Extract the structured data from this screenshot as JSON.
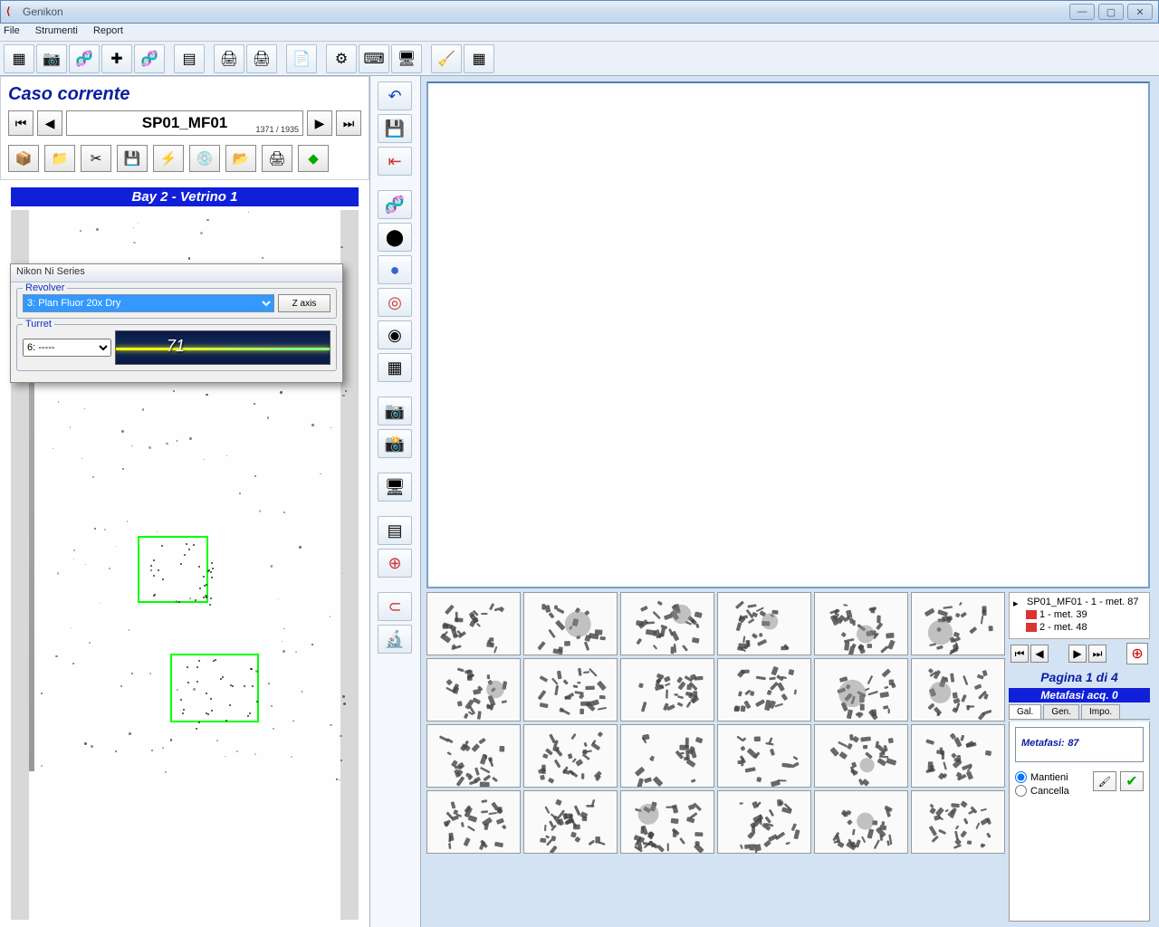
{
  "window": {
    "title": "Genikon"
  },
  "menu": {
    "file": "File",
    "tools": "Strumenti",
    "report": "Report"
  },
  "caso": {
    "title": "Caso corrente",
    "id": "SP01_MF01",
    "counter": "1371 / 1935"
  },
  "bay": {
    "label": "Bay 2 - Vetrino 1"
  },
  "nikon": {
    "title": "Nikon Ni Series",
    "revolver_label": "Revolver",
    "revolver_value": "3: Plan Fluor 20x Dry",
    "zaxis": "Z axis",
    "turret_label": "Turret",
    "turret_value": "6: -----",
    "turret_digit": "71"
  },
  "tree": {
    "root": "SP01_MF01 - 1 - met. 87",
    "child1": "1 - met. 39",
    "child2": "2 - met. 48"
  },
  "pager": {
    "label": "Pagina 1 di 4"
  },
  "acq": {
    "label": "Metafasi acq. 0"
  },
  "tabs": {
    "gal": "Gal.",
    "gen": "Gen.",
    "impo": "Impo."
  },
  "gal": {
    "metafasi_label": "Metafasi:",
    "metafasi_count": "87",
    "mantieni": "Mantieni",
    "cancella": "Cancella"
  }
}
